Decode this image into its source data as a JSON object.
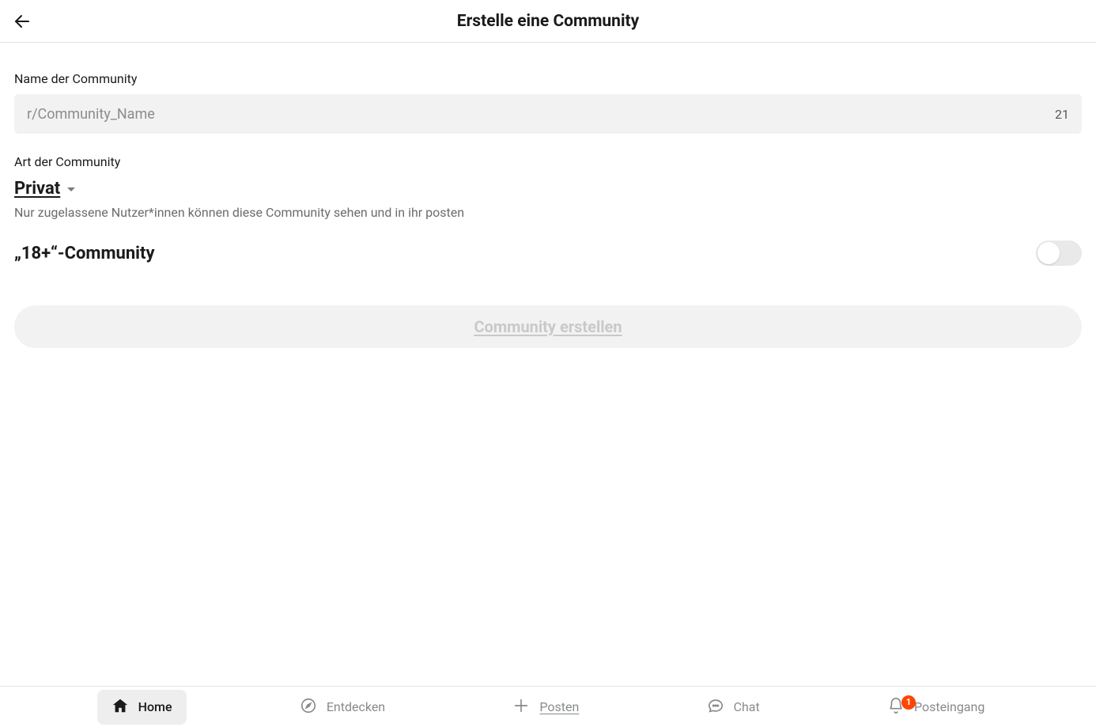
{
  "header": {
    "title": "Erstelle eine Community"
  },
  "form": {
    "name_label": "Name der Community",
    "name_placeholder": "r/Community_Name",
    "name_value": "",
    "char_remaining": "21",
    "type_label": "Art der Community",
    "type_value": "Privat",
    "type_description": "Nur zugelassene Nutzer*innen können diese Community sehen und in ihr posten",
    "adult_label": "„18+“-Community",
    "adult_toggle_state": "off",
    "submit_label": "Community erstellen"
  },
  "nav": {
    "home": "Home",
    "discover": "Entdecken",
    "post": "Posten",
    "chat": "Chat",
    "inbox": "Posteingang",
    "inbox_badge": "1"
  }
}
